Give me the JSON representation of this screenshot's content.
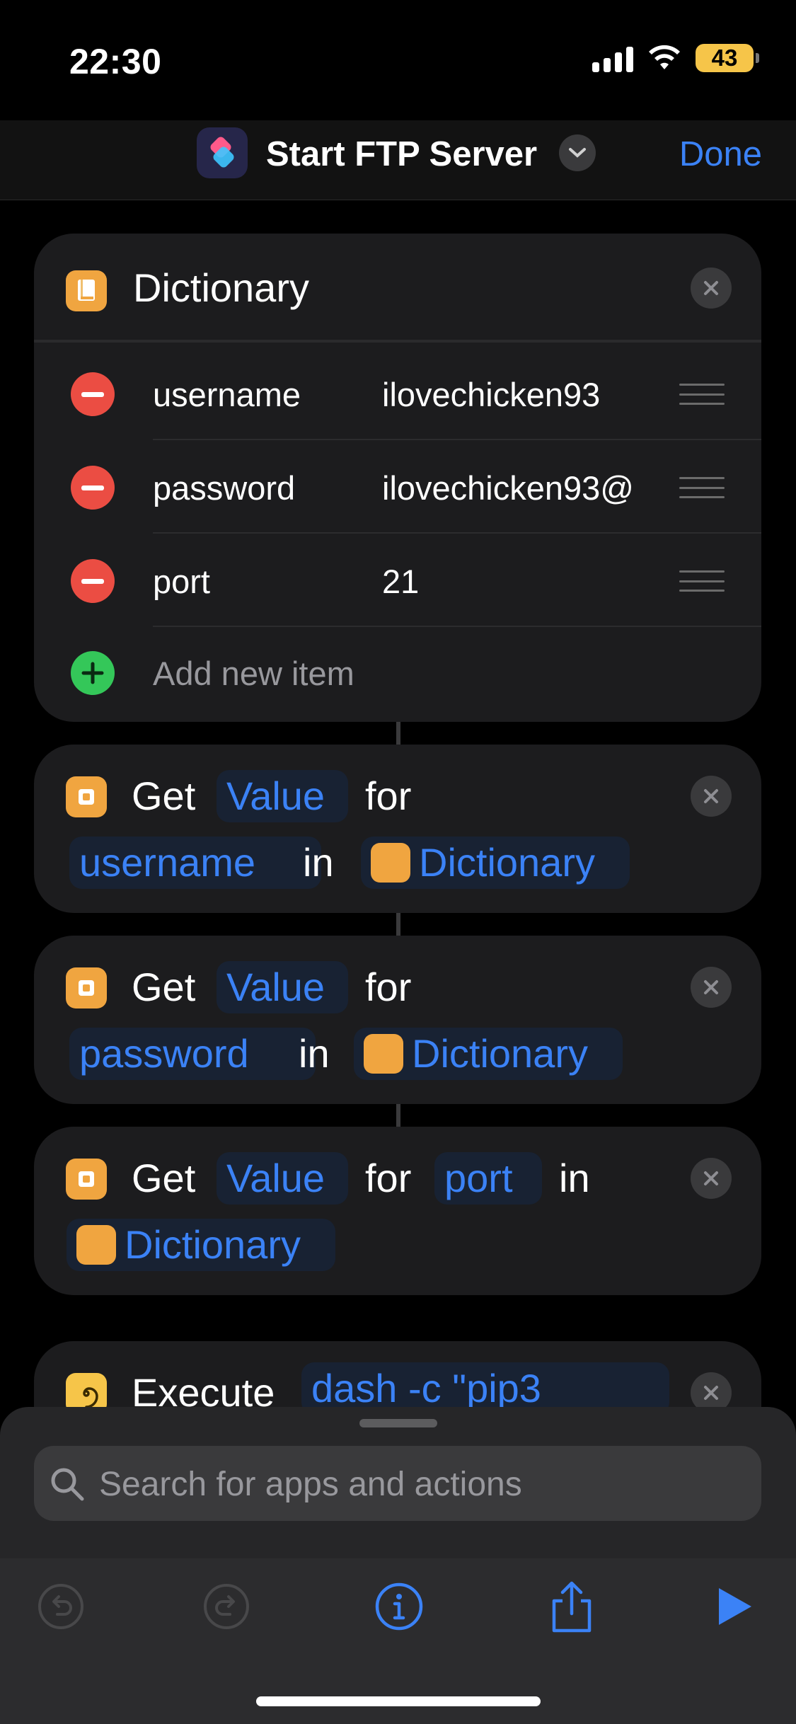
{
  "status_bar": {
    "time": "22:30",
    "battery": "43"
  },
  "header": {
    "title": "Start FTP Server",
    "done_label": "Done"
  },
  "dictionary_card": {
    "title": "Dictionary",
    "items": [
      {
        "key": "username",
        "value": "ilovechicken93"
      },
      {
        "key": "password",
        "value": "ilovechicken93@"
      },
      {
        "key": "port",
        "value": "21"
      }
    ],
    "add_label": "Add new item"
  },
  "get_actions": [
    {
      "verb": "Get",
      "value_token": "Value",
      "for_word": "for",
      "key_token": "username",
      "in_word": "in",
      "dict_token": "Dictionary"
    },
    {
      "verb": "Get",
      "value_token": "Value",
      "for_word": "for",
      "key_token": "password",
      "in_word": "in",
      "dict_token": "Dictionary"
    },
    {
      "verb": "Get",
      "value_token": "Value",
      "for_word": "for",
      "key_token": "port",
      "in_word": "in",
      "dict_token": "Dictionary"
    }
  ],
  "execute_action": {
    "verb": "Execute",
    "command_token": "dash -c \"pip3"
  },
  "search": {
    "placeholder": "Search for apps and actions"
  },
  "colors": {
    "accent": "#3b82f6",
    "card": "#1c1c1e",
    "action_icon": "#f0a540",
    "remove": "#eb4d43",
    "add": "#34c759"
  },
  "icons": [
    "signal-icon",
    "wifi-icon",
    "battery-icon",
    "shortcuts-app-icon",
    "chevron-down-icon",
    "close-icon",
    "book-icon",
    "spiral-icon",
    "search-icon",
    "undo-icon",
    "redo-icon",
    "info-icon",
    "share-icon",
    "play-icon"
  ]
}
